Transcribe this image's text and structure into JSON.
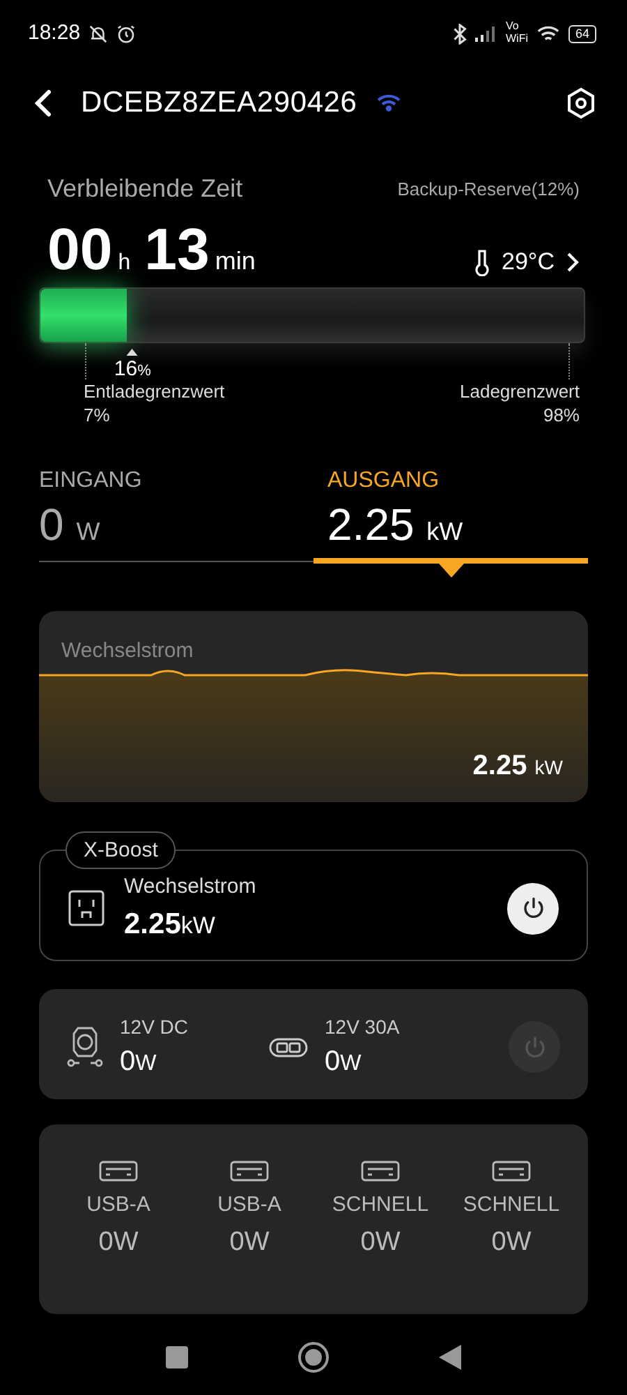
{
  "status_bar": {
    "time": "18:28",
    "vo_label": "Vo",
    "wifi_label": "WiFi",
    "battery": "64"
  },
  "header": {
    "title": "DCEBZ8ZEA290426"
  },
  "battery": {
    "remaining_label": "Verbleibende Zeit",
    "backup": "Backup-Reserve(12%)",
    "hours": "00",
    "hours_unit": "h",
    "minutes": "13",
    "minutes_unit": "min",
    "temperature": "29°C",
    "level": 0.16,
    "level_text": "16",
    "level_unit": "%",
    "discharge_label": "Entladegrenzwert",
    "discharge_value": "7%",
    "charge_label": "Ladegrenzwert",
    "charge_value": "98%"
  },
  "tabs": [
    {
      "label": "EINGANG",
      "value": "0",
      "unit": "W",
      "selected": false
    },
    {
      "label": "AUSGANG",
      "value": "2.25",
      "unit": "kW",
      "selected": true
    }
  ],
  "graph": {
    "title": "Wechselstrom",
    "value": "2.25",
    "unit": "kW"
  },
  "xboost": {
    "badge": "X-Boost",
    "name": "Wechselstrom",
    "value": "2.25",
    "unit": "kW",
    "on": true
  },
  "dc": {
    "on": false,
    "ports": [
      {
        "kind": "car",
        "name": "12V DC",
        "value": "0",
        "unit": "W"
      },
      {
        "kind": "anderson",
        "name": "12V 30A",
        "value": "0",
        "unit": "W"
      }
    ]
  },
  "usb": [
    {
      "label": "USB-A",
      "value": "0W"
    },
    {
      "label": "USB-A",
      "value": "0W"
    },
    {
      "label": "SCHNELL",
      "value": "0W"
    },
    {
      "label": "SCHNELL",
      "value": "0W"
    }
  ]
}
